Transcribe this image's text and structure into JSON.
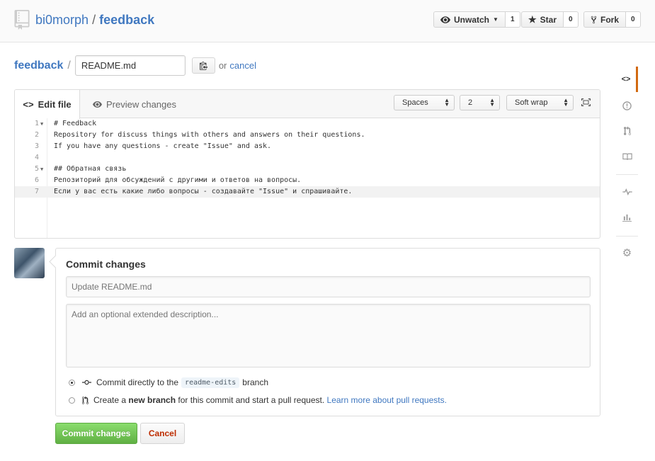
{
  "header": {
    "owner": "bi0morph",
    "separator": "/",
    "repo": "feedback",
    "watch": {
      "label": "Unwatch",
      "count": "1"
    },
    "star": {
      "label": "Star",
      "count": "0"
    },
    "fork": {
      "label": "Fork",
      "count": "0"
    }
  },
  "breadcrumb": {
    "repo": "feedback",
    "separator": "/",
    "filename": "README.md",
    "or_text": "or",
    "cancel": "cancel"
  },
  "editor": {
    "tabs": {
      "edit": "Edit file",
      "preview": "Preview changes"
    },
    "indent_mode": "Spaces",
    "indent_size": "2",
    "wrap_mode": "Soft wrap",
    "lines": [
      {
        "n": "1",
        "fold": true,
        "text": "# Feedback"
      },
      {
        "n": "2",
        "fold": false,
        "text": "Repository for discuss things with others and answers on their questions."
      },
      {
        "n": "3",
        "fold": false,
        "text": "If you have any questions - create \"Issue\" and ask."
      },
      {
        "n": "4",
        "fold": false,
        "text": ""
      },
      {
        "n": "5",
        "fold": true,
        "text": "## Обратная связь"
      },
      {
        "n": "6",
        "fold": false,
        "text": "Репозиторий для обсуждений с другими и ответов на вопросы."
      },
      {
        "n": "7",
        "fold": false,
        "text": "Если у вас есть какие либо вопросы - создавайте \"Issue\" и спрашивайте."
      }
    ],
    "active_line": "7"
  },
  "commit": {
    "title": "Commit changes",
    "summary_placeholder": "Update README.md",
    "description_placeholder": "Add an optional extended description...",
    "option_direct": {
      "prefix": "Commit directly to the",
      "branch": "readme-edits",
      "suffix": "branch"
    },
    "option_new": {
      "prefix": "Create a",
      "bold": "new branch",
      "suffix": "for this commit and start a pull request.",
      "link": "Learn more about pull requests."
    },
    "submit": "Commit changes",
    "cancel": "Cancel"
  },
  "sidenav": [
    "code-icon",
    "issues-icon",
    "pull-request-icon",
    "wiki-icon",
    "pulse-icon",
    "graphs-icon",
    "settings-icon"
  ],
  "colors": {
    "link": "#4078c0",
    "primary": "#60b044",
    "danger": "#bd2c00",
    "selected_nav": "#d26911"
  }
}
